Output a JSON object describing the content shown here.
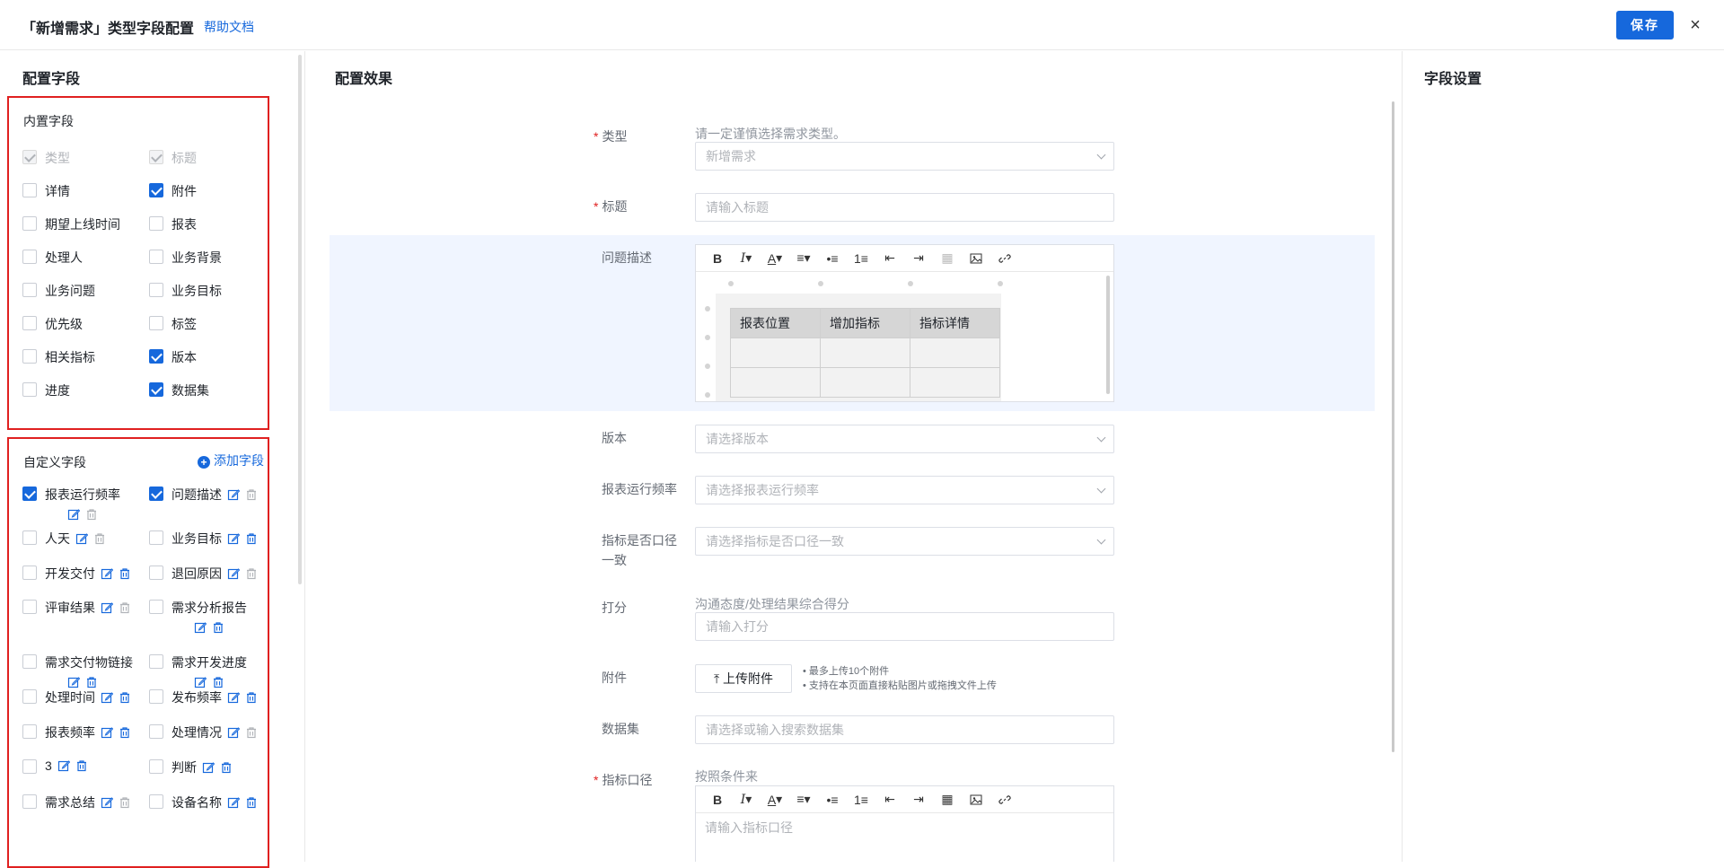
{
  "header": {
    "title": "「新增需求」类型字段配置",
    "help_link": "帮助文档",
    "save_label": "保存",
    "close_glyph": "×"
  },
  "left": {
    "title": "配置字段",
    "builtin": {
      "title": "内置字段",
      "items": [
        {
          "label": "类型",
          "state": "disabled"
        },
        {
          "label": "标题",
          "state": "disabled"
        },
        {
          "label": "详情",
          "state": "unchecked"
        },
        {
          "label": "附件",
          "state": "checked"
        },
        {
          "label": "期望上线时间",
          "state": "unchecked"
        },
        {
          "label": "报表",
          "state": "unchecked"
        },
        {
          "label": "处理人",
          "state": "unchecked"
        },
        {
          "label": "业务背景",
          "state": "unchecked"
        },
        {
          "label": "业务问题",
          "state": "unchecked"
        },
        {
          "label": "业务目标",
          "state": "unchecked"
        },
        {
          "label": "优先级",
          "state": "unchecked"
        },
        {
          "label": "标签",
          "state": "unchecked"
        },
        {
          "label": "相关指标",
          "state": "unchecked"
        },
        {
          "label": "版本",
          "state": "checked"
        },
        {
          "label": "进度",
          "state": "unchecked"
        },
        {
          "label": "数据集",
          "state": "checked"
        }
      ]
    },
    "custom": {
      "title": "自定义字段",
      "add_label": "添加字段",
      "items": [
        {
          "label": "报表运行频率",
          "state": "checked"
        },
        {
          "label": "问题描述",
          "state": "checked"
        },
        {
          "label": "人天",
          "state": "unchecked"
        },
        {
          "label": "业务目标",
          "state": "unchecked"
        },
        {
          "label": "开发交付",
          "state": "unchecked"
        },
        {
          "label": "退回原因",
          "state": "unchecked"
        },
        {
          "label": "评审结果",
          "state": "unchecked"
        },
        {
          "label": "需求分析报告",
          "state": "unchecked"
        },
        {
          "label": "需求交付物链接",
          "state": "unchecked"
        },
        {
          "label": "需求开发进度",
          "state": "unchecked"
        },
        {
          "label": "处理时间",
          "state": "unchecked"
        },
        {
          "label": "发布频率",
          "state": "unchecked"
        },
        {
          "label": "报表频率",
          "state": "unchecked"
        },
        {
          "label": "处理情况",
          "state": "unchecked"
        },
        {
          "label": "3",
          "state": "unchecked"
        },
        {
          "label": "判断",
          "state": "unchecked"
        },
        {
          "label": "需求总结",
          "state": "unchecked"
        },
        {
          "label": "设备名称",
          "state": "unchecked"
        }
      ]
    }
  },
  "middle": {
    "title": "配置效果",
    "type_field": {
      "label": "类型",
      "hint": "请一定谨慎选择需求类型。",
      "value": "新增需求"
    },
    "title_field": {
      "label": "标题",
      "placeholder": "请输入标题"
    },
    "desc_field": {
      "label": "问题描述",
      "table_headers": [
        "报表位置",
        "增加指标",
        "指标详情"
      ]
    },
    "version_field": {
      "label": "版本",
      "placeholder": "请选择版本"
    },
    "freq_field": {
      "label": "报表运行频率",
      "placeholder": "请选择报表运行频率"
    },
    "consistent_field": {
      "label": "指标是否口径一致",
      "placeholder": "请选择指标是否口径一致"
    },
    "score_field": {
      "label": "打分",
      "hint": "沟通态度/处理结果综合得分",
      "placeholder": "请输入打分"
    },
    "attach_field": {
      "label": "附件",
      "button": "上传附件",
      "tip1": "• 最多上传10个附件",
      "tip2": "• 支持在本页面直接粘贴图片或拖拽文件上传"
    },
    "dataset_field": {
      "label": "数据集",
      "placeholder": "请选择或输入搜索数据集"
    },
    "metric_field": {
      "label": "指标口径",
      "hint": "按照条件来",
      "placeholder": "请输入指标口径"
    },
    "required_mark": "*"
  },
  "right": {
    "title": "字段设置"
  },
  "colors": {
    "accent": "#1668dc",
    "highlight_border": "#e02020",
    "selected_row_bg": "#f0f5ff"
  }
}
